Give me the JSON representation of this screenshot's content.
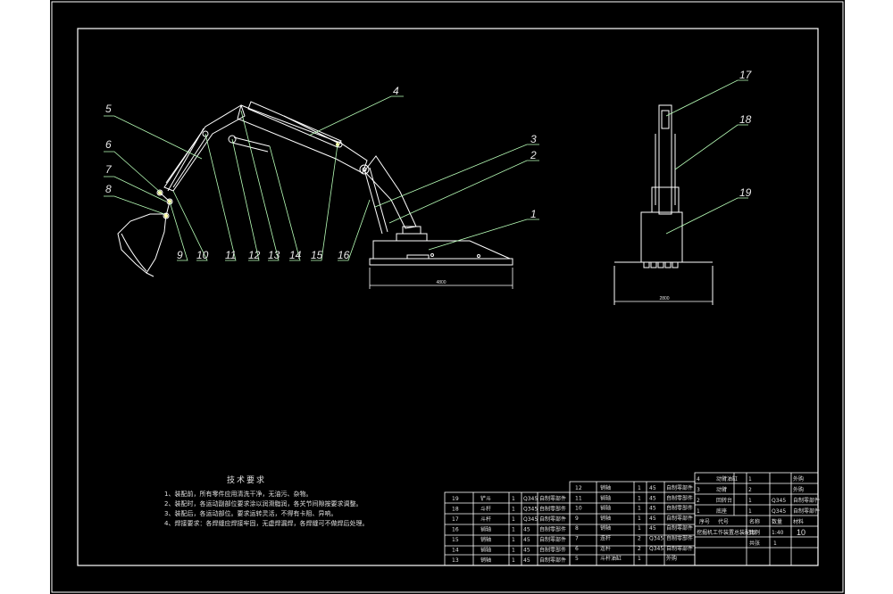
{
  "drawing": {
    "balloons_side": [
      "5",
      "6",
      "7",
      "8",
      "9",
      "10",
      "11",
      "12",
      "13",
      "14",
      "15",
      "16",
      "1",
      "2",
      "3",
      "4"
    ],
    "balloons_front": [
      "17",
      "18",
      "19"
    ],
    "dim_side": "4800",
    "dim_front": "2800"
  },
  "tech_notes": {
    "title": "技术要求",
    "lines": [
      "1、装配前，所有零件应用清洗干净，无油污、杂物。",
      "2、装配时，各运动副部位要求涂以润滑脂润，各关节间隙按要求调整。",
      "3、装配后，各运动部位。要求运转灵活，不得有卡阻、异响。",
      "4、焊接要求：各焊缝应焊接牢固，无虚焊漏焊，各焊缝可不做焊后处理。"
    ]
  },
  "bom_left": [
    {
      "no": "19",
      "name": "铲斗",
      "qty": "1",
      "mat": "Q345",
      "note": "自制零部件"
    },
    {
      "no": "18",
      "name": "斗杆",
      "qty": "1",
      "mat": "Q345",
      "note": "自制零部件"
    },
    {
      "no": "17",
      "name": "斗杆",
      "qty": "1",
      "mat": "Q345",
      "note": "自制零部件"
    },
    {
      "no": "16",
      "name": "销轴",
      "qty": "1",
      "mat": "45",
      "note": "自制零部件"
    },
    {
      "no": "15",
      "name": "销轴",
      "qty": "1",
      "mat": "45",
      "note": "自制零部件"
    },
    {
      "no": "14",
      "name": "销轴",
      "qty": "1",
      "mat": "45",
      "note": "自制零部件"
    },
    {
      "no": "13",
      "name": "销轴",
      "qty": "1",
      "mat": "45",
      "note": "自制零部件"
    }
  ],
  "bom_mid": [
    {
      "no": "12",
      "name": "销轴",
      "qty": "1",
      "mat": "45",
      "note": "自制零部件"
    },
    {
      "no": "11",
      "name": "销轴",
      "qty": "1",
      "mat": "45",
      "note": "自制零部件"
    },
    {
      "no": "10",
      "name": "销轴",
      "qty": "1",
      "mat": "45",
      "note": "自制零部件"
    },
    {
      "no": "9",
      "name": "销轴",
      "qty": "1",
      "mat": "45",
      "note": "自制零部件"
    },
    {
      "no": "8",
      "name": "销轴",
      "qty": "1",
      "mat": "45",
      "note": "自制零部件"
    },
    {
      "no": "7",
      "name": "连杆",
      "qty": "2",
      "mat": "Q345",
      "note": "自制零部件"
    },
    {
      "no": "6",
      "name": "连杆",
      "qty": "2",
      "mat": "Q345",
      "note": "自制零部件"
    },
    {
      "no": "5",
      "name": "斗杆油缸",
      "qty": "1",
      "mat": "",
      "note": "外购"
    }
  ],
  "bom_right": [
    {
      "no": "4",
      "name": "动臂油缸",
      "qty": "1",
      "mat": "",
      "note": "外购"
    },
    {
      "no": "3",
      "name": "动臂",
      "qty": "2",
      "mat": "",
      "note": "外购"
    },
    {
      "no": "2",
      "name": "回转台",
      "qty": "1",
      "mat": "Q345",
      "note": "自制零部件"
    },
    {
      "no": "1",
      "name": "底座",
      "qty": "1",
      "mat": "Q345",
      "note": "自制零部件"
    }
  ],
  "title_block": {
    "h_no": "序号",
    "h_code": "代号",
    "h_name": "名称",
    "h_qty": "数量",
    "h_mat": "材料",
    "h_note": "备注",
    "drawing_name": "挖掘机工作装置总装配图",
    "scale_label": "比例",
    "scale": "1:40",
    "sheet_label": "共张",
    "sheet": "1",
    "big_no": "10"
  },
  "colors": {
    "frame": "#ffffff",
    "drawing": "#ffffff",
    "accent": "#ffffaa",
    "leader": "#b8ffb8"
  }
}
